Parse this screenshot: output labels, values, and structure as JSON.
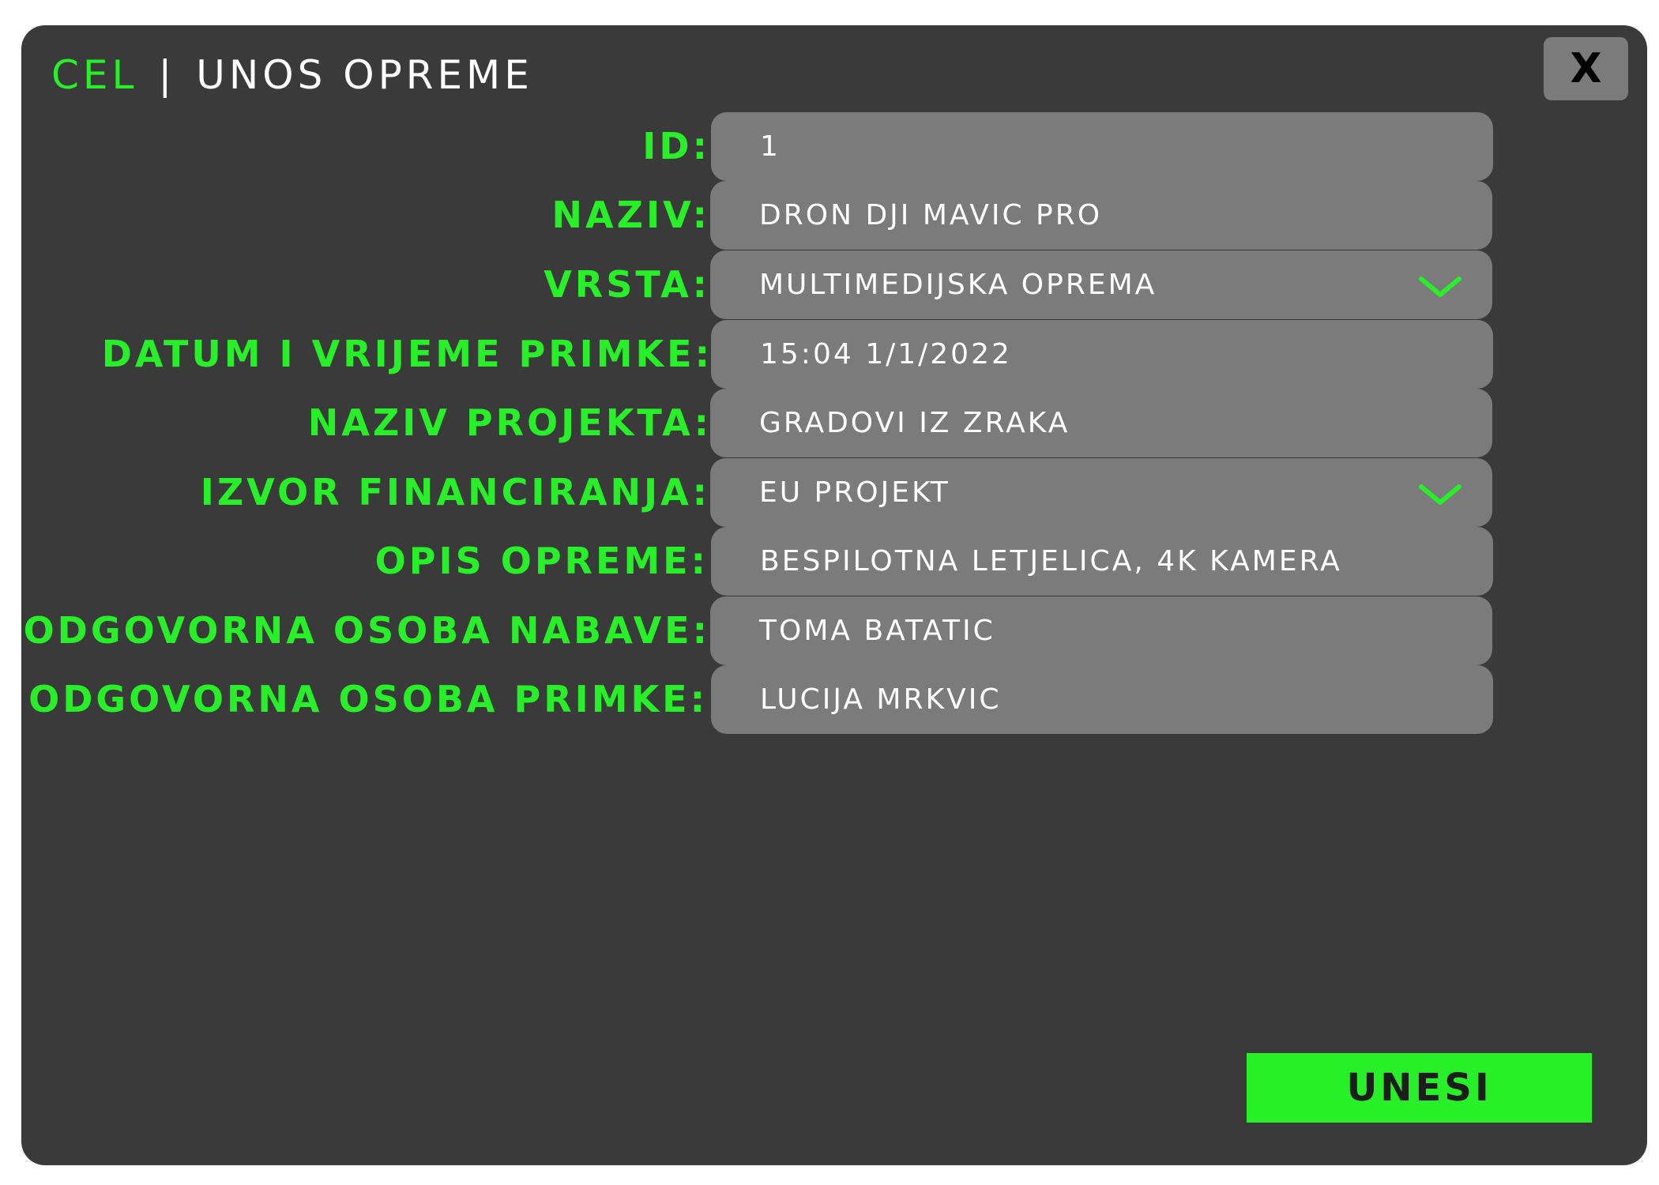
{
  "header": {
    "brand": "CEL",
    "separator": "|",
    "title": "UNOS OPREME",
    "close_label": "X"
  },
  "form": {
    "fields": [
      {
        "label": "ID:",
        "value": "1"
      },
      {
        "label": "NAZIV:",
        "value": "DRON DJI MAVIC PRO"
      },
      {
        "label": "VRSTA:",
        "value": "MULTIMEDIJSKA OPREMA"
      },
      {
        "label": "DATUM I VRIJEME PRIMKE:",
        "value": "15:04 1/1/2022"
      },
      {
        "label": "NAZIV PROJEKTA:",
        "value": "GRADOVI IZ ZRAKA"
      },
      {
        "label": "IZVOR FINANCIRANJA:",
        "value": "EU PROJEKT"
      },
      {
        "label": "OPIS OPREME:",
        "value": "BESPILOTNA LETJELICA, 4K KAMERA"
      },
      {
        "label": "ODGOVORNA OSOBA NABAVE:",
        "value": "TOMA BATATIC"
      },
      {
        "label": "ODGOVORNA OSOBA PRIMKE:",
        "value": "LUCIJA MRKVIC"
      }
    ],
    "submit_label": "UNESI"
  },
  "icons": {
    "dropdown": "chevron-down-icon"
  },
  "colors": {
    "accent": "#28f028",
    "panel": "#3a3a3a",
    "field": "#7b7b7b",
    "text": "#ffffff"
  }
}
